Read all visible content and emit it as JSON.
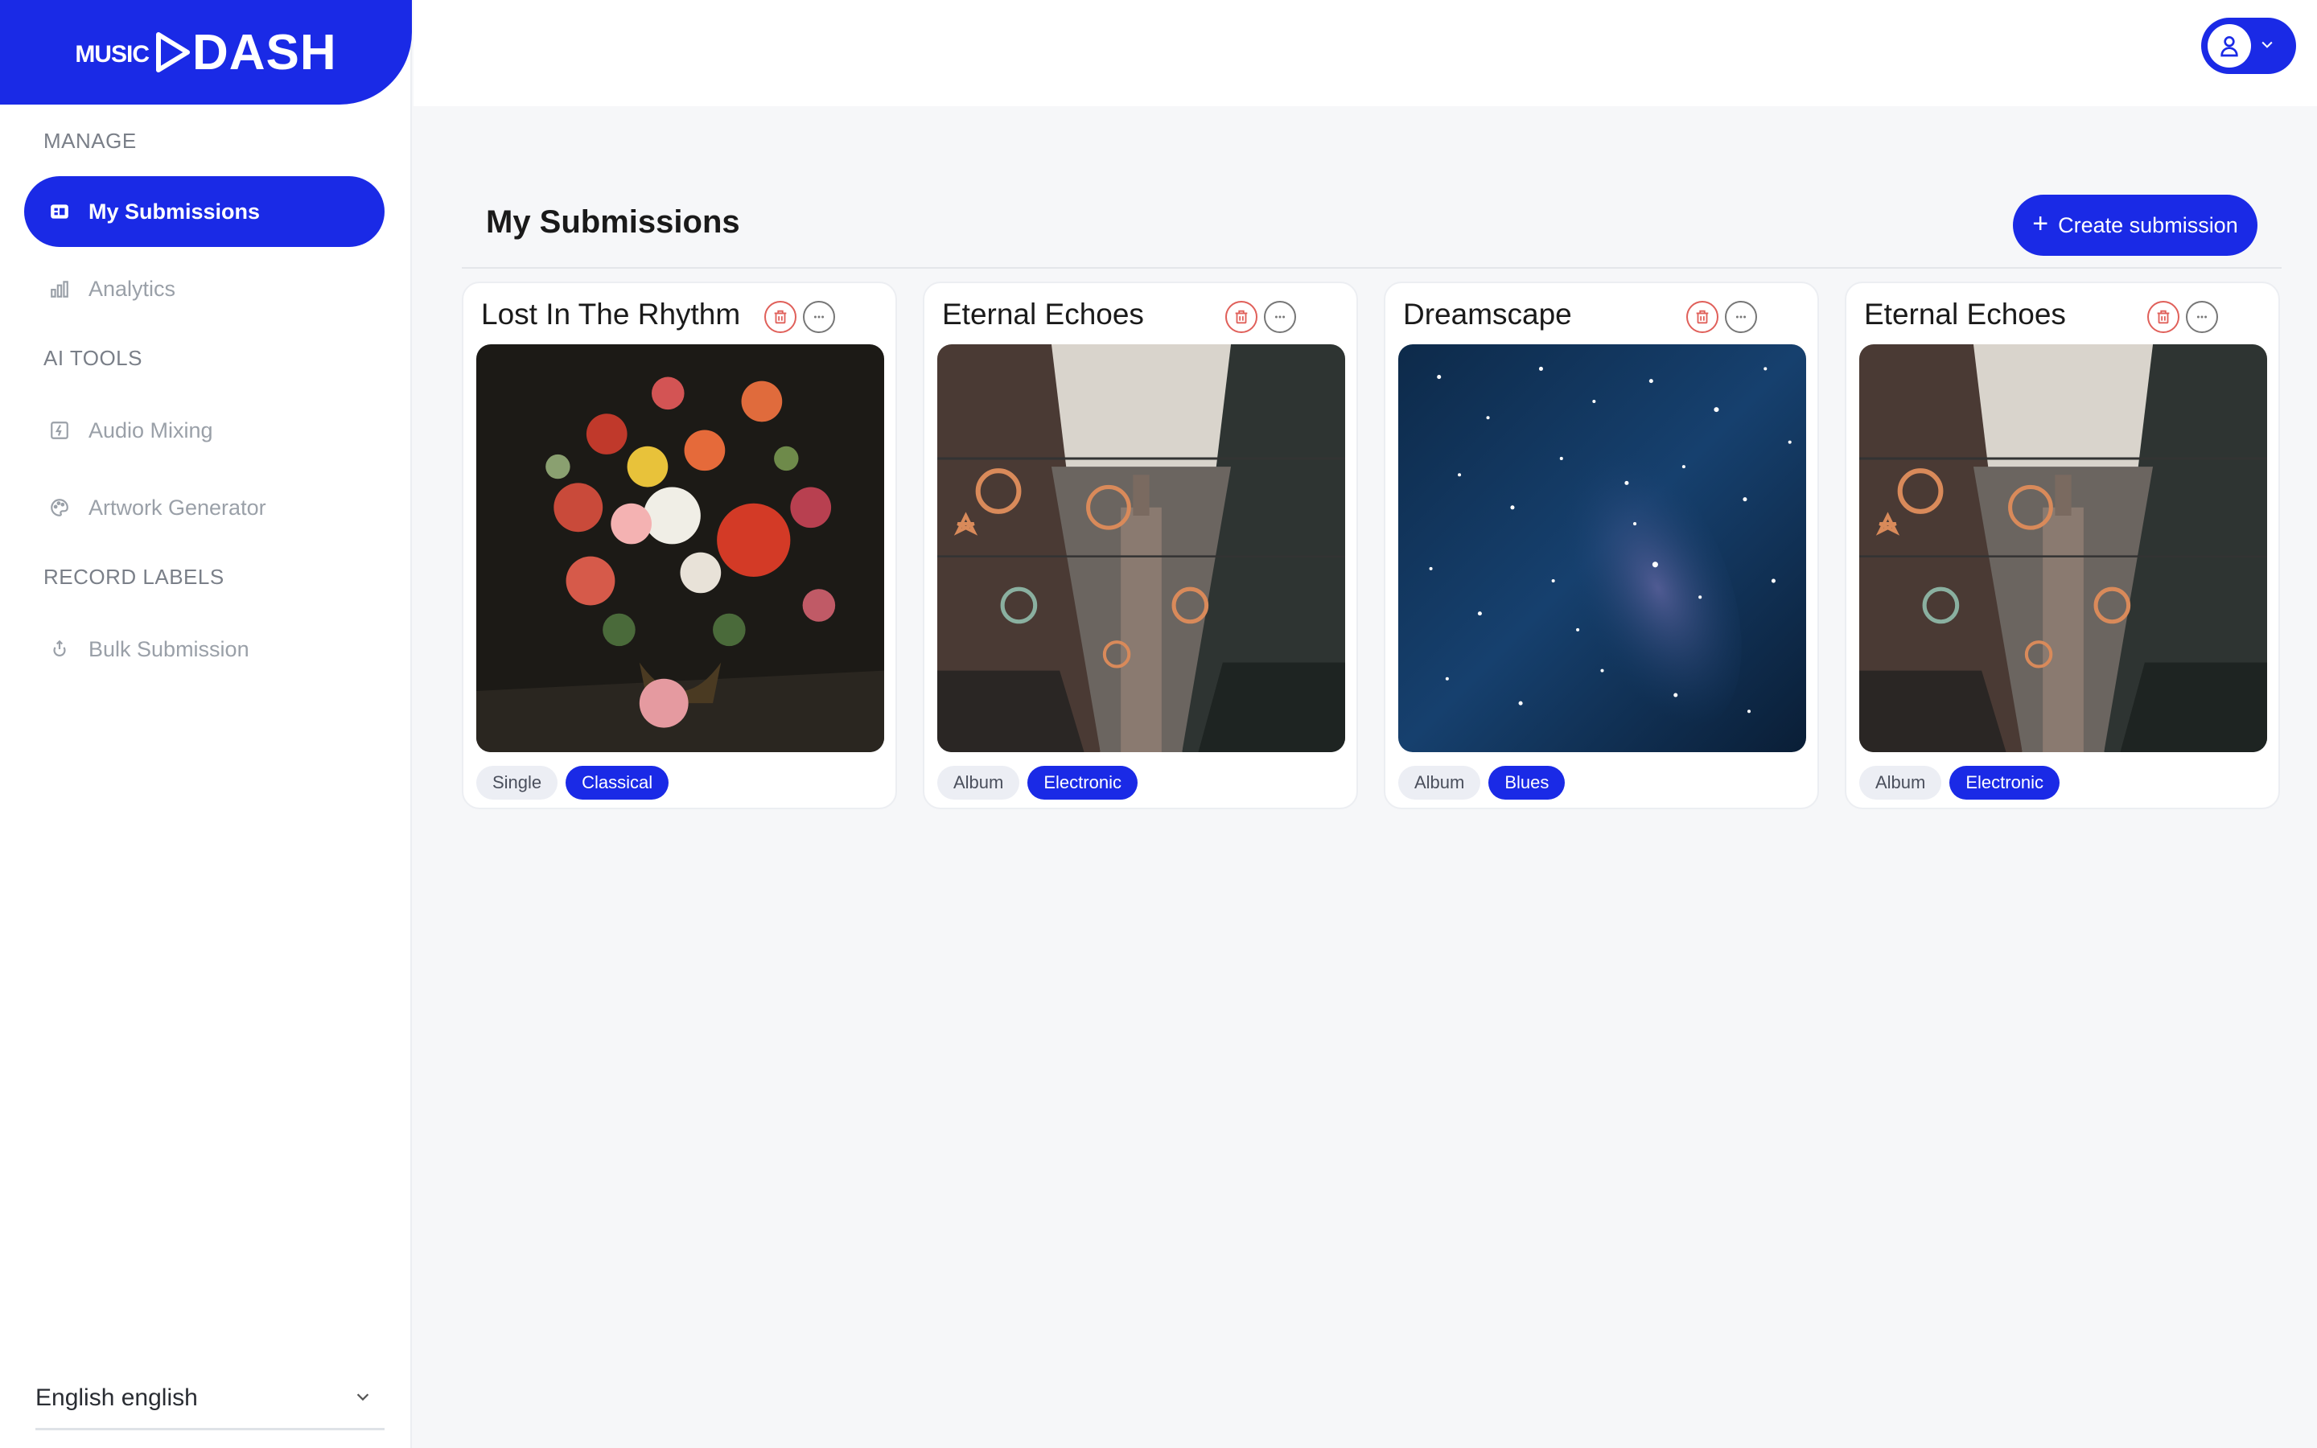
{
  "brand": {
    "music": "MUSIC",
    "dash": "DASH"
  },
  "sidebar": {
    "sections": [
      {
        "label": "MANAGE"
      },
      {
        "label": "AI TOOLS"
      },
      {
        "label": "RECORD LABELS"
      }
    ],
    "items": [
      {
        "label": "My Submissions",
        "icon": "submissions-icon",
        "active": true
      },
      {
        "label": "Analytics",
        "icon": "bar-chart-icon"
      },
      {
        "label": "Audio Mixing",
        "icon": "mixing-icon"
      },
      {
        "label": "Artwork Generator",
        "icon": "palette-icon"
      },
      {
        "label": "Bulk Submission",
        "icon": "upload-icon"
      }
    ],
    "language": "English english"
  },
  "main": {
    "title": "My Submissions",
    "create_label": "Create submission",
    "cards": [
      {
        "title": "Lost In The Rhythm",
        "type": "Single",
        "genre": "Classical",
        "art": "flowers-painting"
      },
      {
        "title": "Eternal Echoes",
        "type": "Album",
        "genre": "Electronic",
        "art": "city-street-lights"
      },
      {
        "title": "Dreamscape",
        "type": "Album",
        "genre": "Blues",
        "art": "starry-night-sky"
      },
      {
        "title": "Eternal Echoes",
        "type": "Album",
        "genre": "Electronic",
        "art": "city-street-lights"
      }
    ]
  },
  "colors": {
    "accent": "#1a2ae6",
    "danger": "#e0605a",
    "background": "#f6f7f9"
  }
}
